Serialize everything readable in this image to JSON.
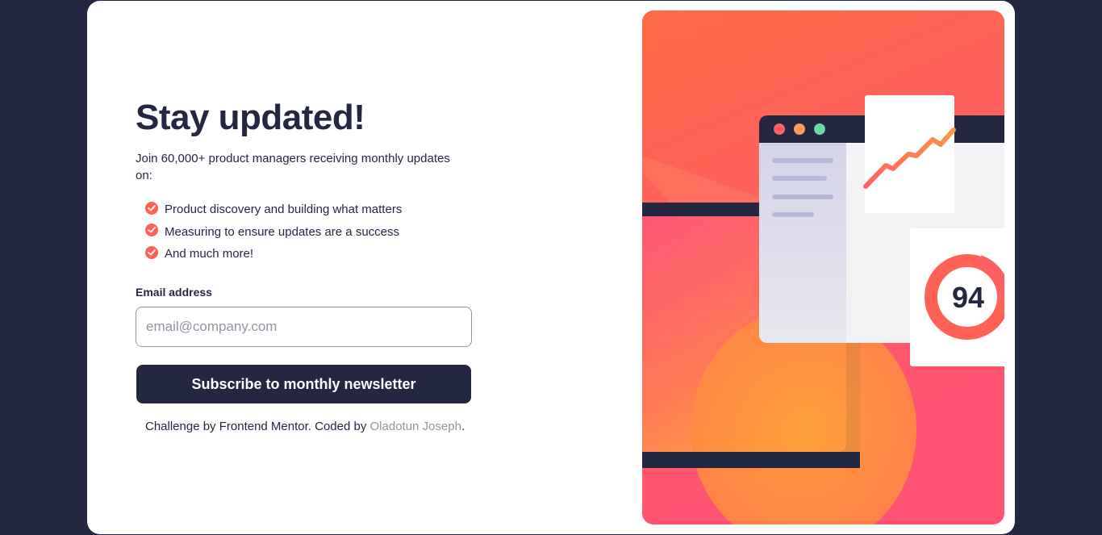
{
  "signup": {
    "title": "Stay updated!",
    "intro": "Join 60,000+ product managers receiving monthly updates on:",
    "features": [
      "Product discovery and building what matters",
      "Measuring to ensure updates are a success",
      "And much more!"
    ],
    "email_label": "Email address",
    "email_placeholder": "email@company.com",
    "email_value": "",
    "subscribe_label": "Subscribe to monthly newsletter"
  },
  "attribution": {
    "prefix": "Challenge by Frontend Mentor. Coded by ",
    "author": "Oladotun Joseph",
    "suffix": "."
  },
  "illustration": {
    "score": "94"
  },
  "colors": {
    "page_background": "#242742",
    "dark_navy": "#242742",
    "tomato": "#ff6155",
    "grey": "#9294a0",
    "white": "#ffffff"
  },
  "icons": [
    "check-icon"
  ]
}
